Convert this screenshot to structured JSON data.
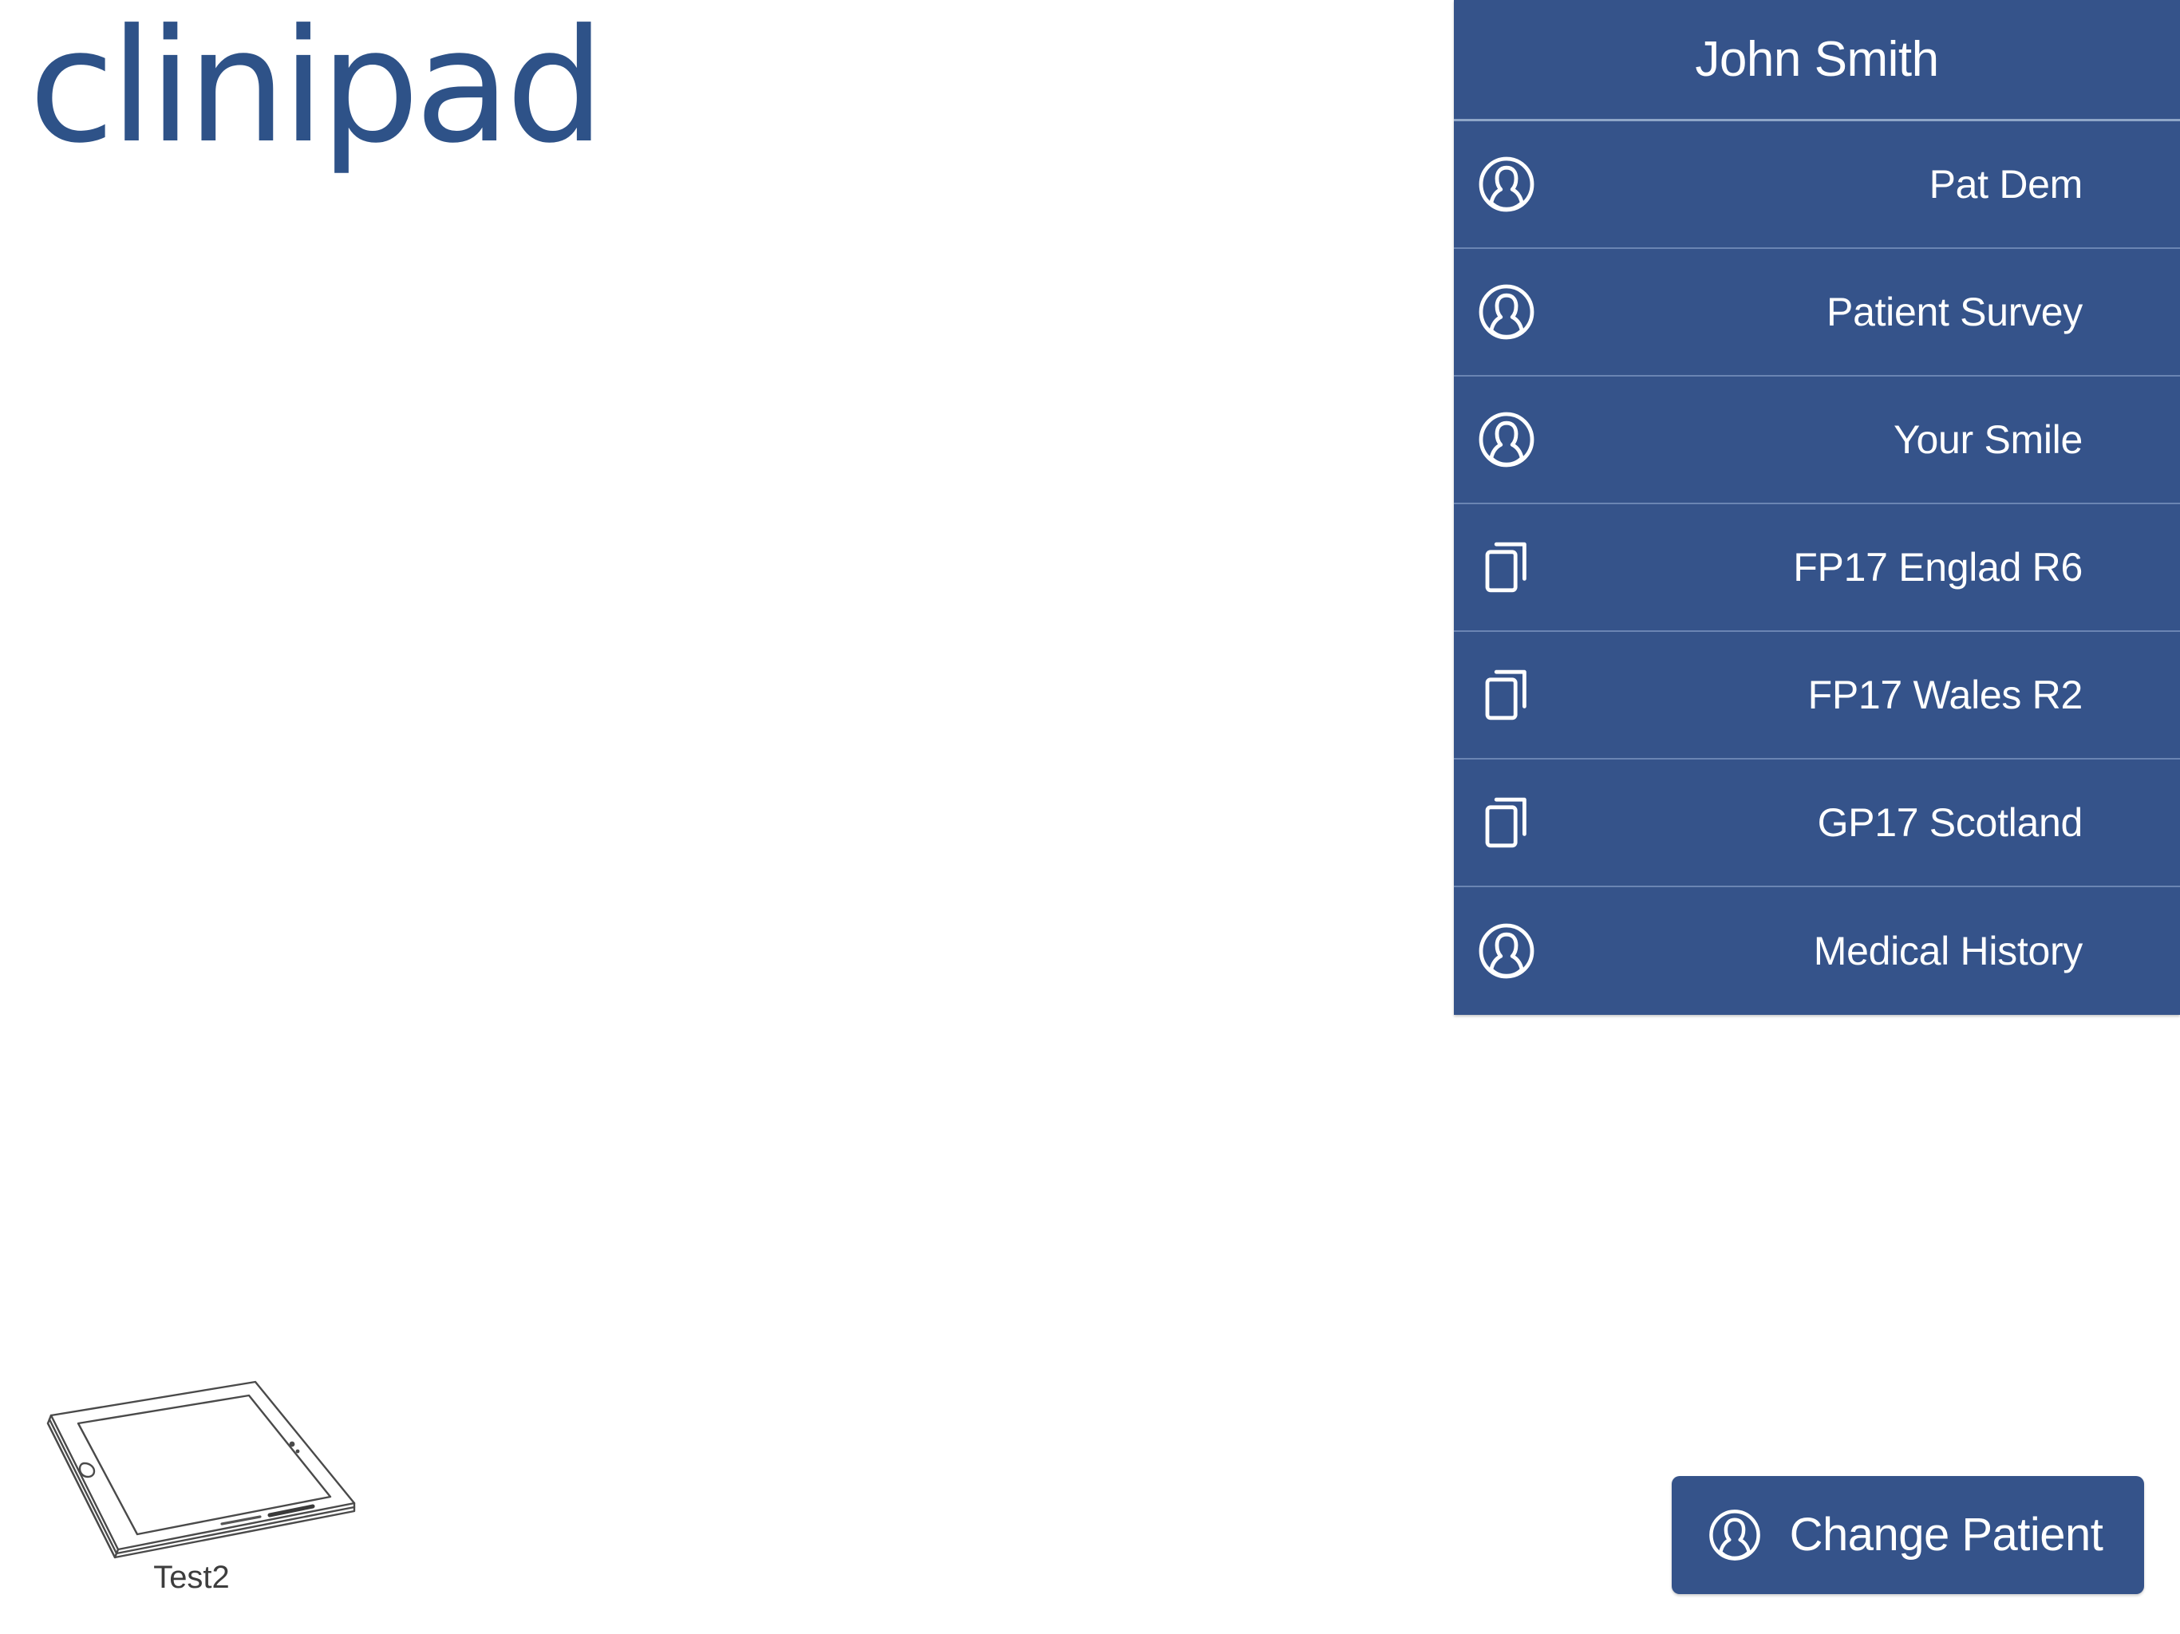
{
  "brand": {
    "logo_text": "clinipad",
    "logo_color": "#2e5288"
  },
  "theme": {
    "panel_blue": "#35538a",
    "panel_divider": "#6b85b3",
    "header_divider": "#8fa6c8",
    "text_on_blue": "#ffffff",
    "page_background": "#ffffff",
    "illustration_stroke": "#4a4a4a"
  },
  "patient_panel": {
    "header": {
      "patient_name": "John Smith"
    },
    "items": [
      {
        "label": "Pat Dem",
        "icon": "person-icon"
      },
      {
        "label": "Patient Survey",
        "icon": "person-icon"
      },
      {
        "label": "Your Smile",
        "icon": "person-icon"
      },
      {
        "label": "FP17 Englad R6",
        "icon": "documents-icon"
      },
      {
        "label": "FP17 Wales R2",
        "icon": "documents-icon"
      },
      {
        "label": "GP17 Scotland",
        "icon": "documents-icon"
      },
      {
        "label": "Medical History",
        "icon": "person-icon"
      }
    ]
  },
  "device": {
    "label": "Test2",
    "icon": "tablet-illustration"
  },
  "actions": {
    "change_patient": {
      "label": "Change Patient",
      "icon": "person-icon"
    }
  }
}
